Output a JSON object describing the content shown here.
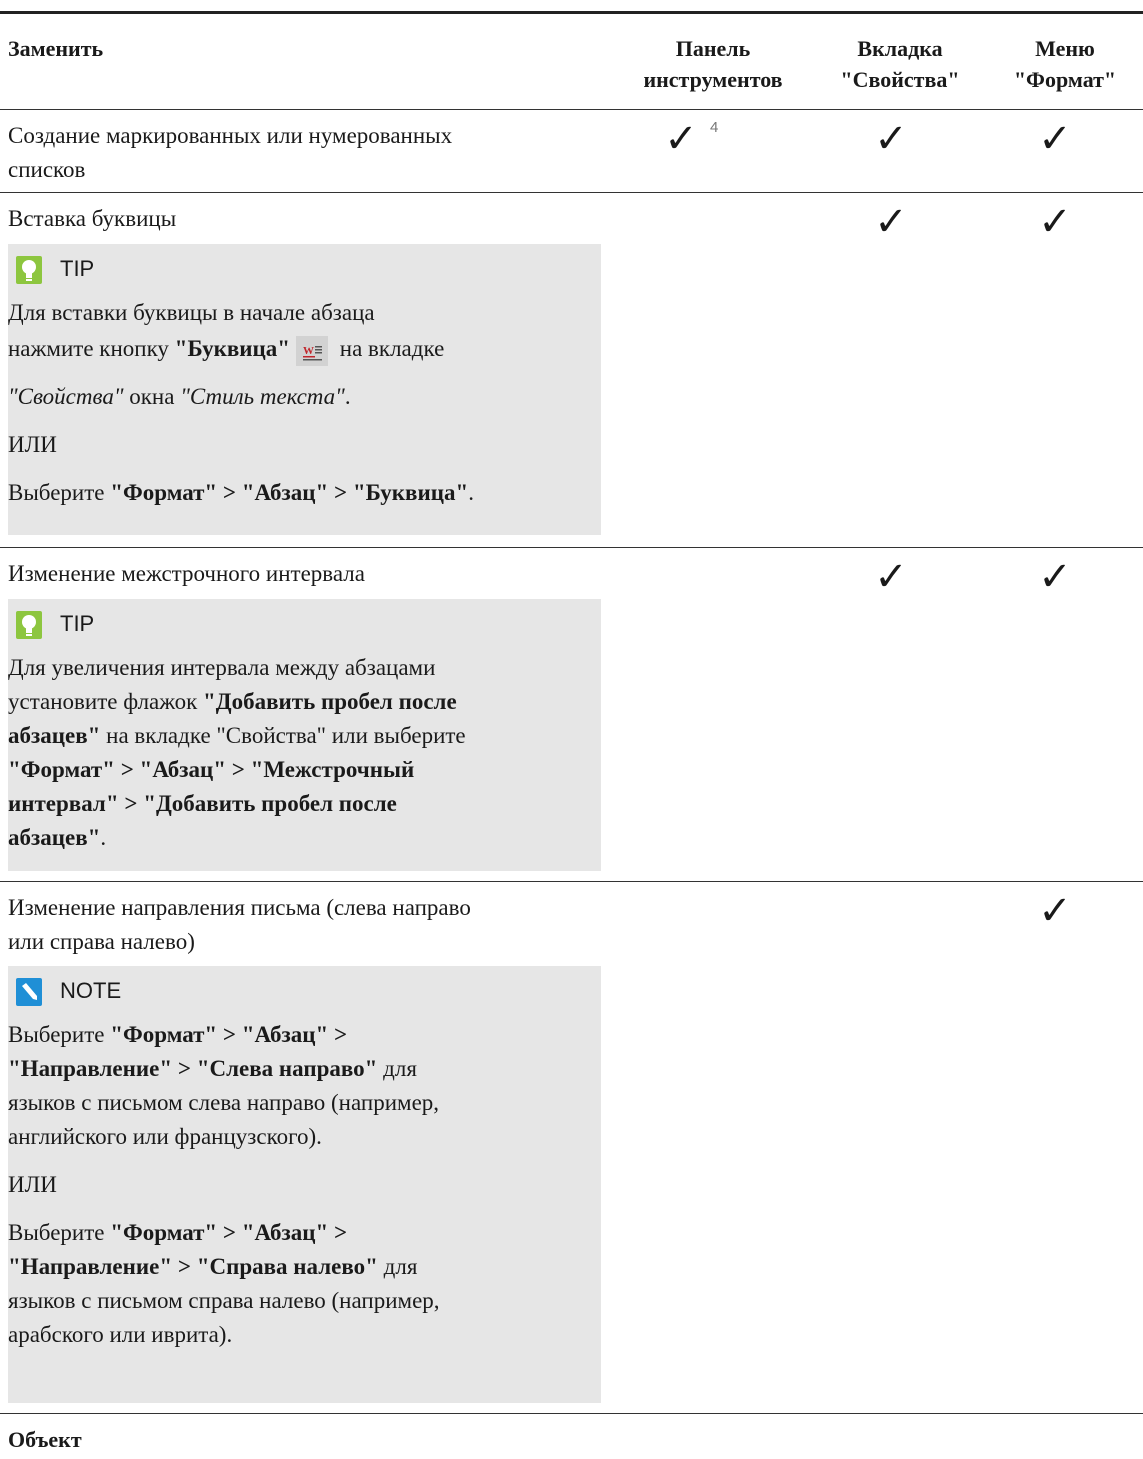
{
  "header": {
    "col_replace": "Заменить",
    "col_toolbar_1": "Панель",
    "col_toolbar_2": "инструментов",
    "col_tab_1": "Вкладка",
    "col_tab_2": "\"Свойства\"",
    "col_menu_1": "Меню",
    "col_menu_2": "\"Формат\""
  },
  "check_glyph": "✓",
  "rows": [
    {
      "desc_1": "Создание маркированных или нумерованных",
      "desc_2": "списков",
      "footnote": "4"
    },
    {
      "desc_1": "Вставка буквицы",
      "tip": {
        "label": "TIP",
        "l1": "Для вставки буквицы в начале абзаца",
        "l2_pre": "нажмите кнопку ",
        "l2_bold": "\"Буквица\"",
        "l2_post": " на вкладке",
        "l3_it1": "\"Свойства\"",
        "l3_mid": " окна ",
        "l3_it2": "\"Стиль текста\"",
        "l3_end": ".",
        "or": "ИЛИ",
        "l4_pre": "Выберите ",
        "l4_bold": "\"Формат\" > \"Абзац\" > \"Буквица\"",
        "l4_end": "."
      }
    },
    {
      "desc_1": "Изменение межстрочного интервала",
      "tip": {
        "label": "TIP",
        "l1": "Для увеличения интервала между абзацами",
        "l2_pre": "установите флажок ",
        "l2_bold": "\"Добавить пробел после",
        "l3_bold": "абзацев\"",
        "l3_post": " на вкладке \"Свойства\" или выберите",
        "l4_bold": "\"Формат\" > \"Абзац\" > \"Межстрочный",
        "l5_bold": "интервал\" > \"Добавить пробел после",
        "l6_bold": "абзацев\"",
        "l6_end": "."
      }
    },
    {
      "desc_1": "Изменение направления письма (слева направо",
      "desc_2": "или справа налево)",
      "note": {
        "label": "NOTE",
        "a1_pre": "Выберите ",
        "a1_bold": "\"Формат\" > \"Абзац\" >",
        "a2_bold": "\"Направление\" > \"Слева направо\"",
        "a2_post": " для",
        "a3": "языков с письмом слева направо (например,",
        "a4": "английского или французского).",
        "or": "ИЛИ",
        "b1_pre": "Выберите ",
        "b1_bold": "\"Формат\" > \"Абзац\" >",
        "b2_bold": "\"Направление\" > \"Справа налево\"",
        "b2_post": " для",
        "b3": "языков с письмом справа налево (например,",
        "b4": "арабского или иврита)."
      }
    }
  ],
  "section_object": "Объект",
  "colors": {
    "tip_icon": "#8dc63f",
    "note_icon": "#1f8fd6",
    "box_bg": "#e6e6e6",
    "drop_cap_icon": "#c0262c"
  }
}
